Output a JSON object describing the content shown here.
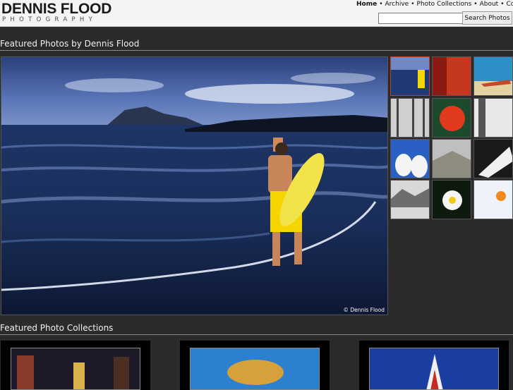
{
  "brand": {
    "name": "DENNIS FLOOD",
    "tagline": "PHOTOGRAPHY"
  },
  "nav": {
    "home": "Home",
    "archive": "Archive",
    "collections": "Photo Collections",
    "about": "About",
    "contact": "Contact",
    "separator": "•"
  },
  "search": {
    "value": "",
    "button": "Search Photos"
  },
  "featured": {
    "title": "Featured Photos by Dennis Flood",
    "copyright": "© Dennis Flood"
  },
  "collections": {
    "title": "Featured Photo Collections"
  },
  "colors": {
    "background": "#2b2b2b",
    "header_bg": "#f4f4f4",
    "active_border": "#c73a2a"
  },
  "thumbnails": [
    {
      "name": "surfer",
      "active": true
    },
    {
      "name": "red-robe",
      "active": false
    },
    {
      "name": "beach-boat",
      "active": false
    },
    {
      "name": "forest-people",
      "active": false
    },
    {
      "name": "red-lantern",
      "active": false
    },
    {
      "name": "bw-sign",
      "active": false
    },
    {
      "name": "cows",
      "active": false
    },
    {
      "name": "grey-landscape",
      "active": false
    },
    {
      "name": "sky-cloud",
      "active": false
    },
    {
      "name": "mountain-lake",
      "active": false
    },
    {
      "name": "daisy",
      "active": false
    },
    {
      "name": "snow-bird",
      "active": false
    }
  ]
}
